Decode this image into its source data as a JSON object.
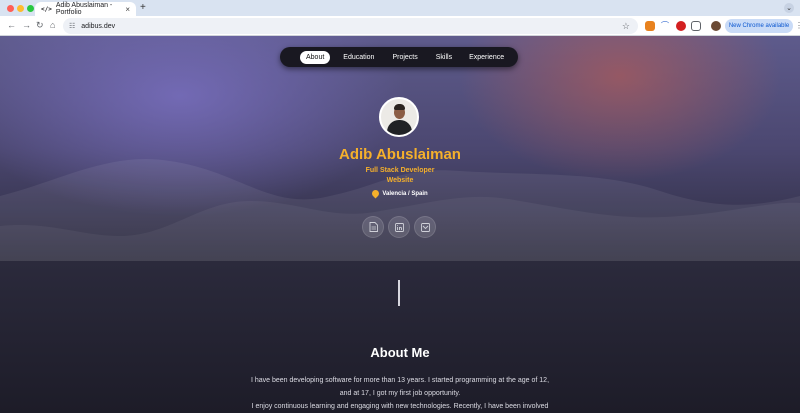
{
  "browser": {
    "tab_title": "Adib Abuslaiman - Portfolio",
    "tab_icon": "code-icon",
    "url": "adibus.dev",
    "update_button": "New Chrome available"
  },
  "nav": {
    "items": [
      "About",
      "Education",
      "Projects",
      "Skills",
      "Experience"
    ],
    "active": "About"
  },
  "hero": {
    "name": "Adib Abuslaiman",
    "role_line1": "Full Stack Developer",
    "role_line2": "Website",
    "location": "Valencia / Spain",
    "social_icons": [
      "document-icon",
      "linkedin-icon",
      "box-icon"
    ]
  },
  "about": {
    "title": "About Me",
    "lines": [
      "I have been developing software for more than 13 years. I started programming at the age of 12,",
      "and at 17, I got my first job opportunity.",
      "I enjoy continuous learning and engaging with new technologies. Recently, I have been involved"
    ]
  },
  "colors": {
    "accent": "#f5b02b",
    "nav_bg": "#191821"
  }
}
